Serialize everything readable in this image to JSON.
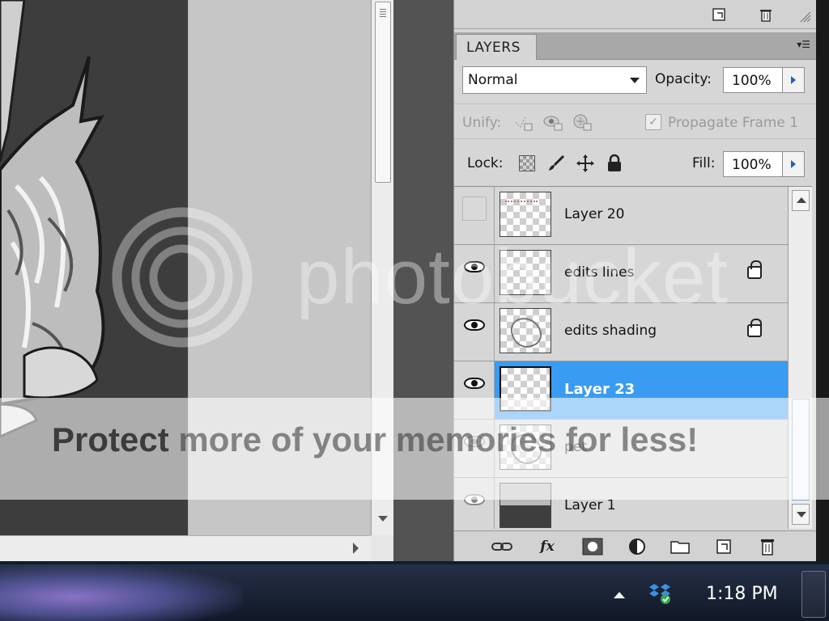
{
  "panel": {
    "tab_label": "LAYERS",
    "blend_mode": "Normal",
    "opacity_label": "Opacity:",
    "opacity_value": "100%",
    "unify_label": "Unify:",
    "propagate_label": "Propagate Frame 1",
    "propagate_checked": true,
    "lock_label": "Lock:",
    "fill_label": "Fill:",
    "fill_value": "100%"
  },
  "layers": [
    {
      "name": "Layer 20",
      "visible": false,
      "locked": false,
      "selected": false,
      "thumb": "red-sketch"
    },
    {
      "name": "edits lines",
      "visible": true,
      "locked": true,
      "selected": false,
      "thumb": "transparent"
    },
    {
      "name": "edits shading",
      "visible": true,
      "locked": true,
      "selected": false,
      "thumb": "sketch"
    },
    {
      "name": "Layer 23",
      "visible": true,
      "locked": false,
      "selected": true,
      "thumb": "transparent"
    },
    {
      "name": "pet",
      "visible": true,
      "locked": false,
      "selected": false,
      "thumb": "sketch"
    },
    {
      "name": "Layer 1",
      "visible": true,
      "locked": false,
      "selected": false,
      "thumb": "solid-gray"
    }
  ],
  "watermark": {
    "word": "photobucket",
    "banner_strong": "Protect",
    "banner_rest": "more of your memories for less!"
  },
  "taskbar": {
    "clock": "1:18 PM"
  },
  "colors": {
    "selection": "#3a9bf2",
    "panel_bg": "#d6d6d6",
    "canvas_dark": "#3d3d3d"
  },
  "icons": {
    "footer": [
      "link-layers-icon",
      "fx-icon",
      "add-mask-icon",
      "adjustment-layer-icon",
      "new-group-icon",
      "new-layer-icon",
      "trash-icon"
    ]
  }
}
